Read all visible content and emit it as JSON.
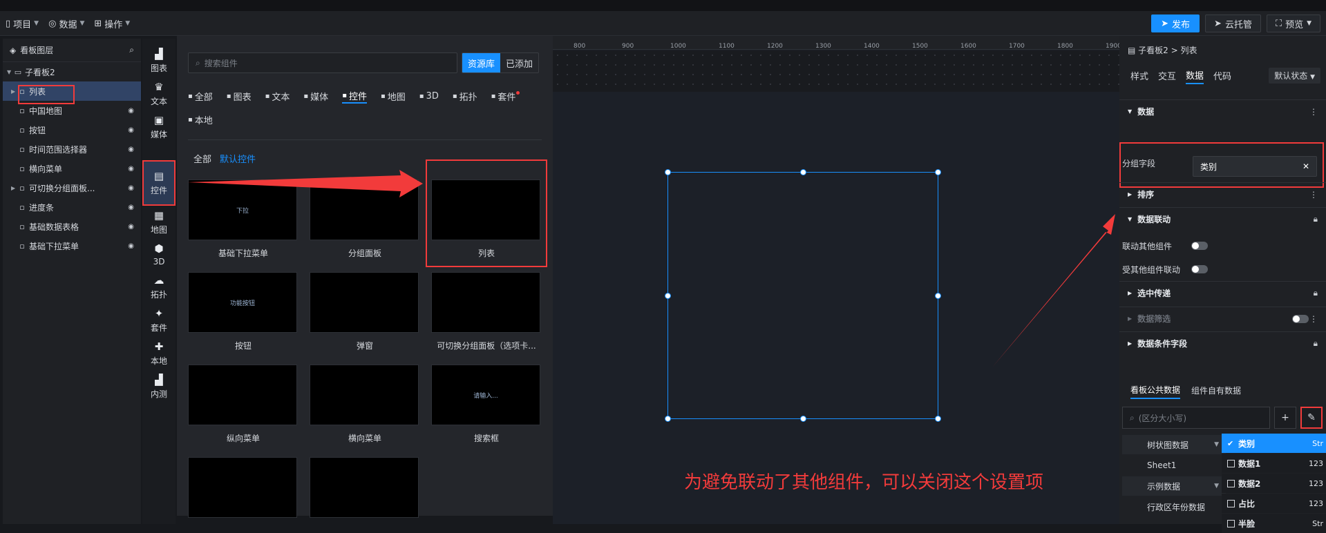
{
  "toolbar": {
    "project": "项目",
    "data": "数据",
    "operation": "操作",
    "publish": "发布",
    "cloud_host": "云托管",
    "preview": "预览"
  },
  "layers": {
    "title": "看板图层",
    "root": "子看板2",
    "items": [
      {
        "label": "列表",
        "icon": "list-icon"
      },
      {
        "label": "中国地图",
        "icon": "map-icon"
      },
      {
        "label": "按钮",
        "icon": "button-icon"
      },
      {
        "label": "时间范围选择器",
        "icon": "calendar-icon"
      },
      {
        "label": "横向菜单",
        "icon": "menu-icon"
      },
      {
        "label": "可切换分组面板...",
        "icon": "panel-icon"
      },
      {
        "label": "进度条",
        "icon": "progress-icon"
      },
      {
        "label": "基础数据表格",
        "icon": "table-icon"
      },
      {
        "label": "基础下拉菜单",
        "icon": "dropdown-icon"
      }
    ]
  },
  "categories": [
    {
      "label": "图表",
      "glyph": "▟"
    },
    {
      "label": "文本",
      "glyph": "♛"
    },
    {
      "label": "媒体",
      "glyph": "▣"
    },
    {
      "label": "控件",
      "glyph": "▤"
    },
    {
      "label": "地图",
      "glyph": "▦"
    },
    {
      "label": "3D",
      "glyph": "⬢"
    },
    {
      "label": "拓扑",
      "glyph": "☁"
    },
    {
      "label": "套件",
      "glyph": "✦"
    },
    {
      "label": "本地",
      "glyph": "✚"
    },
    {
      "label": "内测",
      "glyph": "▟"
    }
  ],
  "library": {
    "search_placeholder": "搜索组件",
    "source_lib": "资源库",
    "added": "已添加",
    "tabs": [
      "全部",
      "图表",
      "文本",
      "媒体",
      "控件",
      "地图",
      "3D",
      "拓扑",
      "套件",
      "本地"
    ],
    "active_tab": "控件",
    "sub_all": "全部",
    "sub_default": "默认控件",
    "cards": [
      {
        "label": "基础下拉菜单",
        "thumb": "下拉"
      },
      {
        "label": "分组面板",
        "thumb": ""
      },
      {
        "label": "列表",
        "thumb": ""
      },
      {
        "label": "按钮",
        "thumb": "功能按钮"
      },
      {
        "label": "弹窗",
        "thumb": ""
      },
      {
        "label": "可切换分组面板（选项卡...",
        "thumb": ""
      },
      {
        "label": "纵向菜单",
        "thumb": ""
      },
      {
        "label": "横向菜单",
        "thumb": ""
      },
      {
        "label": "搜索框",
        "thumb": "请输入..."
      },
      {
        "label": "",
        "thumb": ""
      },
      {
        "label": "",
        "thumb": ""
      }
    ]
  },
  "ruler": [
    "800",
    "900",
    "1000",
    "1100",
    "1200",
    "1300",
    "1400",
    "1500",
    "1600",
    "1700",
    "1800",
    "1900"
  ],
  "annotation": "为避免联动了其他组件，可以关闭这个设置项",
  "right_panel": {
    "breadcrumb": "子看板2 > 列表",
    "tabs": [
      "样式",
      "交互",
      "数据",
      "代码"
    ],
    "active_tab": "数据",
    "state": "默认状态",
    "sec_data": "数据",
    "group_field_label": "分组字段",
    "group_field_value": "类别",
    "sec_sort": "排序",
    "sec_linkage": "数据联动",
    "link_others": "联动其他组件",
    "linked_by_others": "受其他组件联动",
    "sec_selected": "选中传递",
    "sec_filter": "数据筛选",
    "sec_condition": "数据条件字段",
    "bottom_tabs": [
      "看板公共数据",
      "组件自有数据"
    ],
    "search_placeholder": "(区分大小写)",
    "datasets": [
      {
        "label": "树状图数据",
        "group": true
      },
      {
        "label": "Sheet1",
        "group": false
      },
      {
        "label": "示例数据",
        "group": true
      },
      {
        "label": "行政区年份数据",
        "group": false
      }
    ],
    "fields": [
      {
        "label": "类别",
        "type": "Str",
        "checked": true
      },
      {
        "label": "数据1",
        "type": "123",
        "checked": false
      },
      {
        "label": "数据2",
        "type": "123",
        "checked": false
      },
      {
        "label": "占比",
        "type": "123",
        "checked": false
      },
      {
        "label": "半脸",
        "type": "Str",
        "checked": false
      }
    ]
  },
  "colors": {
    "accent": "#1890ff",
    "annotation": "#f23b3b"
  }
}
